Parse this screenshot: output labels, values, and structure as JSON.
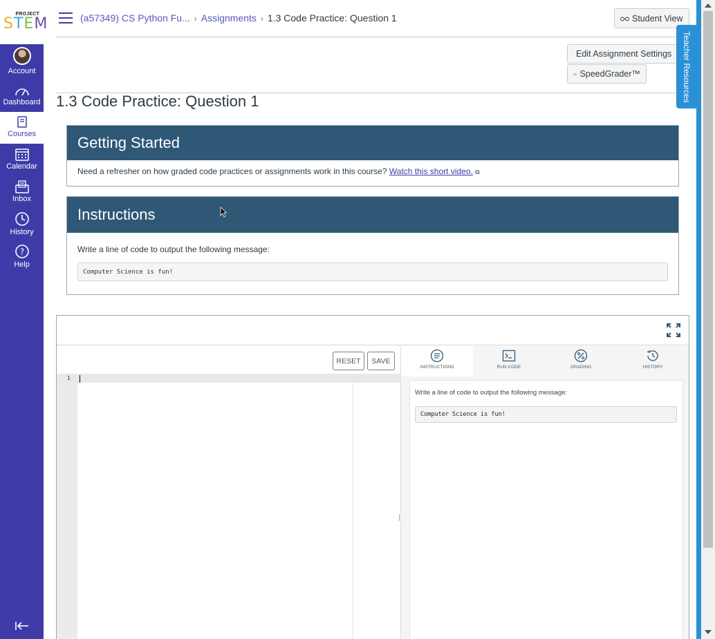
{
  "nav": {
    "logo_small": "PROJECT",
    "logo_letters": [
      "S",
      "T",
      "E",
      "M"
    ],
    "items": [
      {
        "label": "Account"
      },
      {
        "label": "Dashboard"
      },
      {
        "label": "Courses"
      },
      {
        "label": "Calendar"
      },
      {
        "label": "Inbox"
      },
      {
        "label": "History"
      },
      {
        "label": "Help"
      }
    ]
  },
  "breadcrumb": {
    "course": "(a57349) CS Python Fu...",
    "section": "Assignments",
    "current": "1.3 Code Practice: Question 1"
  },
  "header": {
    "student_view": "Student View",
    "edit_settings": "Edit Assignment Settings",
    "speedgrader": "SpeedGrader™",
    "teacher_resources": "Teacher Resources"
  },
  "page_title": "1.3 Code Practice: Question 1",
  "getting_started": {
    "title": "Getting Started",
    "text": "Need a refresher on how graded code practices or assignments work in this course?",
    "link": "Watch this short video."
  },
  "instructions": {
    "title": "Instructions",
    "text": "Write a line of code to output the following message:",
    "code": "Computer Science is fun!"
  },
  "ide": {
    "reset": "RESET",
    "save": "SAVE",
    "line_number": "1",
    "tabs": [
      "INSTRUCTIONS",
      "RUN CODE",
      "GRADING",
      "HISTORY"
    ],
    "panel_text": "Write a line of code to output the following message:",
    "panel_code": "Computer Science is fun!"
  }
}
